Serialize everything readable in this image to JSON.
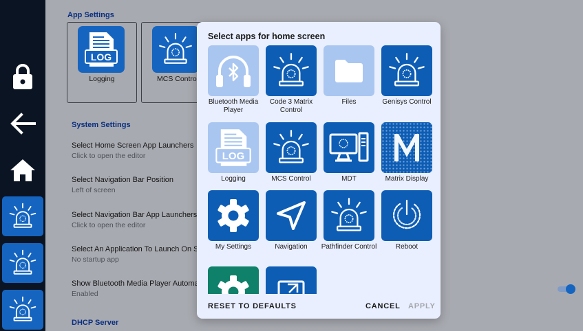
{
  "navbar": {
    "lock_icon": "lock-icon",
    "back_icon": "back-arrow-icon",
    "home_icon": "home-icon",
    "app_shortcuts": [
      "siren-icon",
      "siren-icon",
      "siren-icon"
    ]
  },
  "settings": {
    "app_settings_title": "App Settings",
    "app_cards": [
      {
        "label": "Logging",
        "icon": "log-file-icon"
      },
      {
        "label": "MCS Control",
        "icon": "siren-icon"
      }
    ],
    "system_settings_title": "System Settings",
    "items": [
      {
        "title": "Select Home Screen App Launchers",
        "subtitle": "Click to open the editor"
      },
      {
        "title": "Select Navigation Bar Position",
        "subtitle": "Left of screen"
      },
      {
        "title": "Select Navigation Bar App Launchers",
        "subtitle": "Click to open the editor"
      },
      {
        "title": "Select An Application To Launch On Startup",
        "subtitle": "No startup app"
      },
      {
        "title": "Show Bluetooth Media Player Automatically",
        "subtitle": "Enabled"
      }
    ],
    "dhcp_title": "DHCP Server"
  },
  "dialog": {
    "title": "Select apps for home screen",
    "apps": [
      {
        "label": "Bluetooth Media Player",
        "icon": "bluetooth-headphones-icon",
        "selected": true
      },
      {
        "label": "Code 3 Matrix Control",
        "icon": "siren-icon",
        "selected": false
      },
      {
        "label": "Files",
        "icon": "folder-icon",
        "selected": true
      },
      {
        "label": "Genisys Control",
        "icon": "siren-icon",
        "selected": false
      },
      {
        "label": "Logging",
        "icon": "log-file-icon",
        "selected": true
      },
      {
        "label": "MCS Control",
        "icon": "siren-icon",
        "selected": false
      },
      {
        "label": "MDT",
        "icon": "computer-icon",
        "selected": false
      },
      {
        "label": "Matrix Display",
        "icon": "matrix-display-icon",
        "selected": false
      },
      {
        "label": "My Settings",
        "icon": "gear-icon",
        "selected": false
      },
      {
        "label": "Navigation",
        "icon": "navigation-arrow-icon",
        "selected": false
      },
      {
        "label": "Pathfinder Control",
        "icon": "siren-icon",
        "selected": false
      },
      {
        "label": "Reboot",
        "icon": "reboot-icon",
        "selected": false
      },
      {
        "label": "",
        "icon": "gear-icon",
        "selected": false
      },
      {
        "label": "",
        "icon": "launch-icon",
        "selected": false
      }
    ],
    "reset_label": "RESET TO DEFAULTS",
    "cancel_label": "CANCEL",
    "apply_label": "APPLY"
  },
  "colors": {
    "navbar": "#0b1423",
    "app_blue": "#0d5db5",
    "selected_tile": "#a9c6f1",
    "dialog_bg": "#e9efff",
    "toggle": "#1565c0"
  }
}
